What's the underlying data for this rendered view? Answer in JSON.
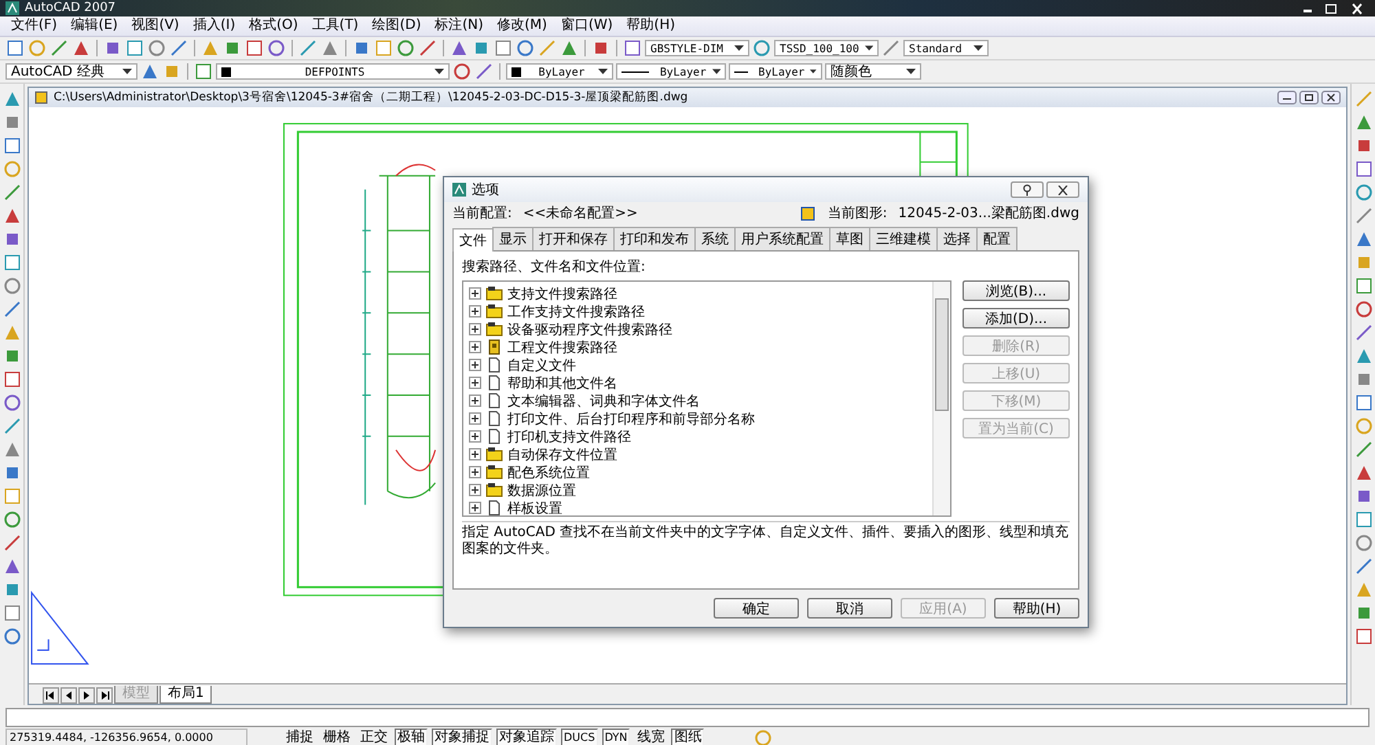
{
  "window": {
    "title": "AutoCAD 2007"
  },
  "menu": [
    "文件(F)",
    "编辑(E)",
    "视图(V)",
    "插入(I)",
    "格式(O)",
    "工具(T)",
    "绘图(D)",
    "标注(N)",
    "修改(M)",
    "窗口(W)",
    "帮助(H)"
  ],
  "toolbar": {
    "text_style": "GBSTYLE-DIM",
    "dim_style": "TSSD_100_100",
    "table_style": "Standard",
    "workspace": "AutoCAD 经典",
    "layer": "DEFPOINTS",
    "color_control": "ByLayer",
    "linetype": "ByLayer",
    "lineweight": "ByLayer",
    "plot_style": "随颜色"
  },
  "document": {
    "title": "C:\\Users\\Administrator\\Desktop\\3号宿舍\\12045-3#宿舍（二期工程）\\12045-2-03-DC-D15-3-屋顶梁配筋图.dwg"
  },
  "dialog": {
    "title": "选项",
    "current_profile_label": "当前配置:",
    "current_profile": "<<未命名配置>>",
    "current_drawing_label": "当前图形:",
    "current_drawing": "12045-2-03...梁配筋图.dwg",
    "tabs": [
      {
        "label": "文件",
        "selected": true
      },
      {
        "label": "显示",
        "selected": false
      },
      {
        "label": "打开和保存",
        "selected": false
      },
      {
        "label": "打印和发布",
        "selected": false
      },
      {
        "label": "系统",
        "selected": false
      },
      {
        "label": "用户系统配置",
        "selected": false
      },
      {
        "label": "草图",
        "selected": false
      },
      {
        "label": "三维建模",
        "selected": false
      },
      {
        "label": "选择",
        "selected": false
      },
      {
        "label": "配置",
        "selected": false
      }
    ],
    "list_label": "搜索路径、文件名和文件位置:",
    "items": [
      {
        "label": "支持文件搜索路径",
        "kind": "folder"
      },
      {
        "label": "工作支持文件搜索路径",
        "kind": "folder"
      },
      {
        "label": "设备驱动程序文件搜索路径",
        "kind": "folder"
      },
      {
        "label": "工程文件搜索路径",
        "kind": "project"
      },
      {
        "label": "自定义文件",
        "kind": "file"
      },
      {
        "label": "帮助和其他文件名",
        "kind": "file"
      },
      {
        "label": "文本编辑器、词典和字体文件名",
        "kind": "file"
      },
      {
        "label": "打印文件、后台打印程序和前导部分名称",
        "kind": "file"
      },
      {
        "label": "打印机支持文件路径",
        "kind": "file"
      },
      {
        "label": "自动保存文件位置",
        "kind": "folder"
      },
      {
        "label": "配色系统位置",
        "kind": "folder"
      },
      {
        "label": "数据源位置",
        "kind": "folder"
      },
      {
        "label": "样板设置",
        "kind": "file"
      }
    ],
    "side_buttons": [
      {
        "label": "浏览(B)...",
        "disabled": false
      },
      {
        "label": "添加(D)...",
        "disabled": false
      },
      {
        "label": "删除(R)",
        "disabled": true
      },
      {
        "label": "上移(U)",
        "disabled": true
      },
      {
        "label": "下移(M)",
        "disabled": true
      },
      {
        "label": "置为当前(C)",
        "disabled": true
      }
    ],
    "description": "指定 AutoCAD 查找不在当前文件夹中的文字字体、自定义文件、插件、要插入的图形、线型和填充图案的文件夹。",
    "buttons": [
      {
        "label": "确定",
        "disabled": false
      },
      {
        "label": "取消",
        "disabled": false
      },
      {
        "label": "应用(A)",
        "disabled": true
      },
      {
        "label": "帮助(H)",
        "disabled": false
      }
    ]
  },
  "layout_tabs": [
    {
      "label": "模型",
      "selected": false
    },
    {
      "label": "布局1",
      "selected": true
    }
  ],
  "status_bar": {
    "coordinates": "275319.4484, -126356.9654, 0.0000",
    "toggles": [
      {
        "label": "捕捉",
        "on": false
      },
      {
        "label": "栅格",
        "on": false
      },
      {
        "label": "正交",
        "on": false
      },
      {
        "label": "极轴",
        "on": true
      },
      {
        "label": "对象捕捉",
        "on": true
      },
      {
        "label": "对象追踪",
        "on": true
      },
      {
        "label": "DUCS",
        "on": true
      },
      {
        "label": "DYN",
        "on": true
      },
      {
        "label": "线宽",
        "on": false
      },
      {
        "label": "图纸",
        "on": true
      }
    ]
  }
}
